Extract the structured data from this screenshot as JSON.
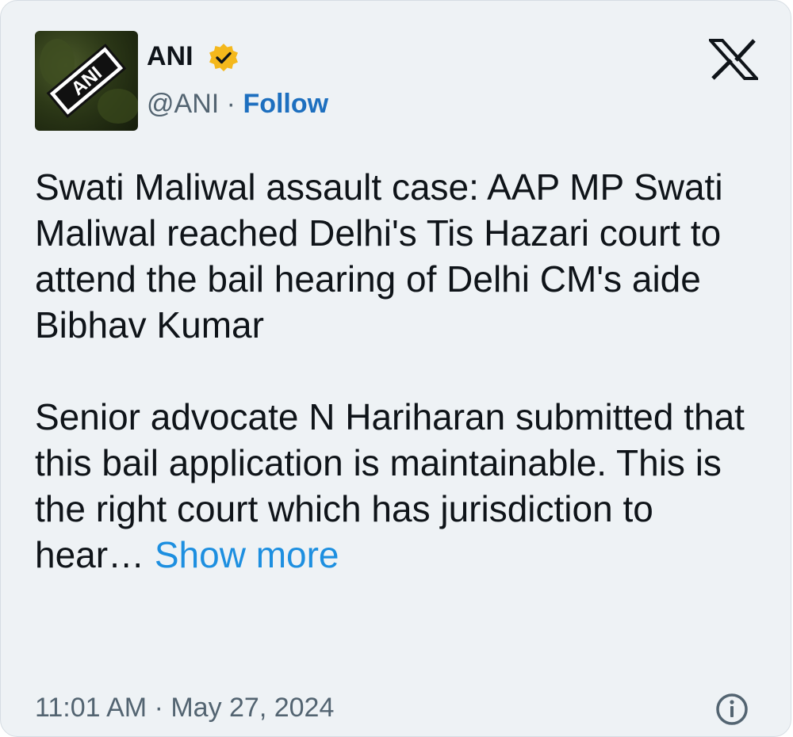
{
  "tweet": {
    "author": {
      "name": "ANI",
      "handle": "@ANI",
      "separator": "·",
      "follow_label": "Follow",
      "avatar_logo_text": "ANI",
      "verified_badge_color": "#f4b81c"
    },
    "platform_icon": "x-logo-icon",
    "body": {
      "paragraph_1": "Swati Maliwal assault case: AAP MP Swati Maliwal reached Delhi's Tis Hazari court to attend the bail hearing of Delhi CM's aide Bibhav Kumar",
      "paragraph_2": "Senior advocate N Hariharan submitted that this bail application is maintainable. This is the right court which has jurisdiction to hear…",
      "show_more_label": "Show more"
    },
    "timestamp": "11:01 AM · May 27, 2024",
    "info_icon": "info-icon"
  },
  "colors": {
    "card_background": "#eef2f5",
    "link_blue": "#1d8fe0",
    "follow_blue": "#1d6fbf",
    "text_primary": "#0f1419",
    "text_secondary": "#536471"
  }
}
